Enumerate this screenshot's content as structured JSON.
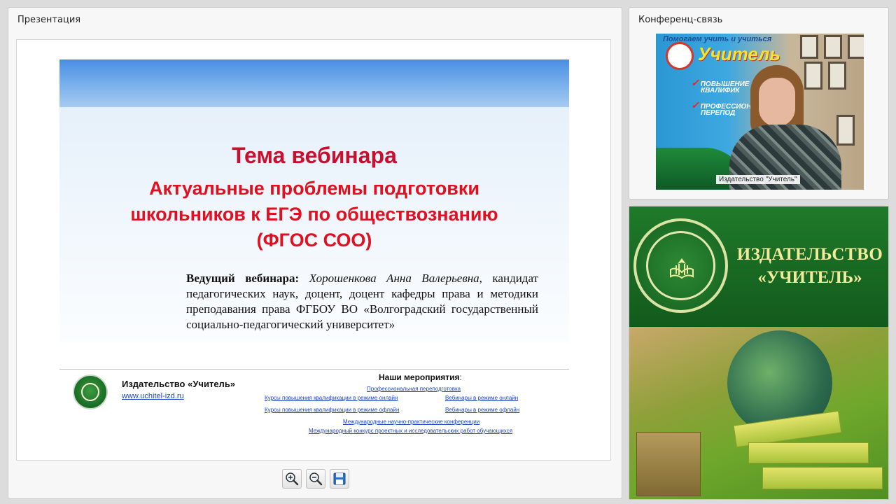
{
  "presentation_panel": {
    "title": "Презентация",
    "slide": {
      "heading": "Тема вебинара",
      "topic_line1": "Актуальные проблемы подготовки",
      "topic_line2": "школьников к ЕГЭ по обществознанию",
      "topic_line3": "(ФГОС СОО)",
      "presenter_label": "Ведущий вебинара:",
      "presenter_name": "Хорошенкова Анна Валерьевна",
      "presenter_info": ", кандидат педагогических наук, доцент, доцент кафедры права и методики преподавания права ФГБОУ ВО «Волгоградский государственный социально-педагогический университет»",
      "footer": {
        "publisher_name": "Издательство «Учитель»",
        "url": "www.uchitel-izd.ru",
        "events_title": "Наши мероприятия",
        "events_colon": ":",
        "events": [
          "Профессиональная переподготовка",
          "Курсы повышения квалификации в режиме онлайн",
          "Вебинары в режиме онлайн",
          "Курсы повышения квалификации в режиме офлайн",
          "Вебинары в режиме офлайн",
          "Международные научно-практические конференции",
          "Международный конкурс проектных и исследовательских работ обучающихся"
        ]
      }
    },
    "toolbar": {
      "zoom_in_icon": "zoom-in-icon",
      "zoom_out_icon": "zoom-out-icon",
      "save_icon": "save-icon"
    }
  },
  "conference_panel": {
    "title": "Конференц-связь",
    "video_caption": "Издательство \"Учитель\"",
    "poster": {
      "head": "Помогаем учить и учиться",
      "brand": "Учитель",
      "line1": "ПОВЫШЕНИЕ",
      "line2": "КВАЛИФИК",
      "line3": "ПРОФЕССИОН",
      "line4": "ПЕРЕПОД"
    }
  },
  "ad_panel": {
    "brand_line1": "ИЗДАТЕЛЬСТВО",
    "brand_line2": "«УЧИТЕЛЬ»"
  },
  "colors": {
    "heading_red": "#c8102e",
    "topic_red": "#e01020",
    "ad_green": "#1f7a2a",
    "ad_text": "#f1eb9c"
  }
}
